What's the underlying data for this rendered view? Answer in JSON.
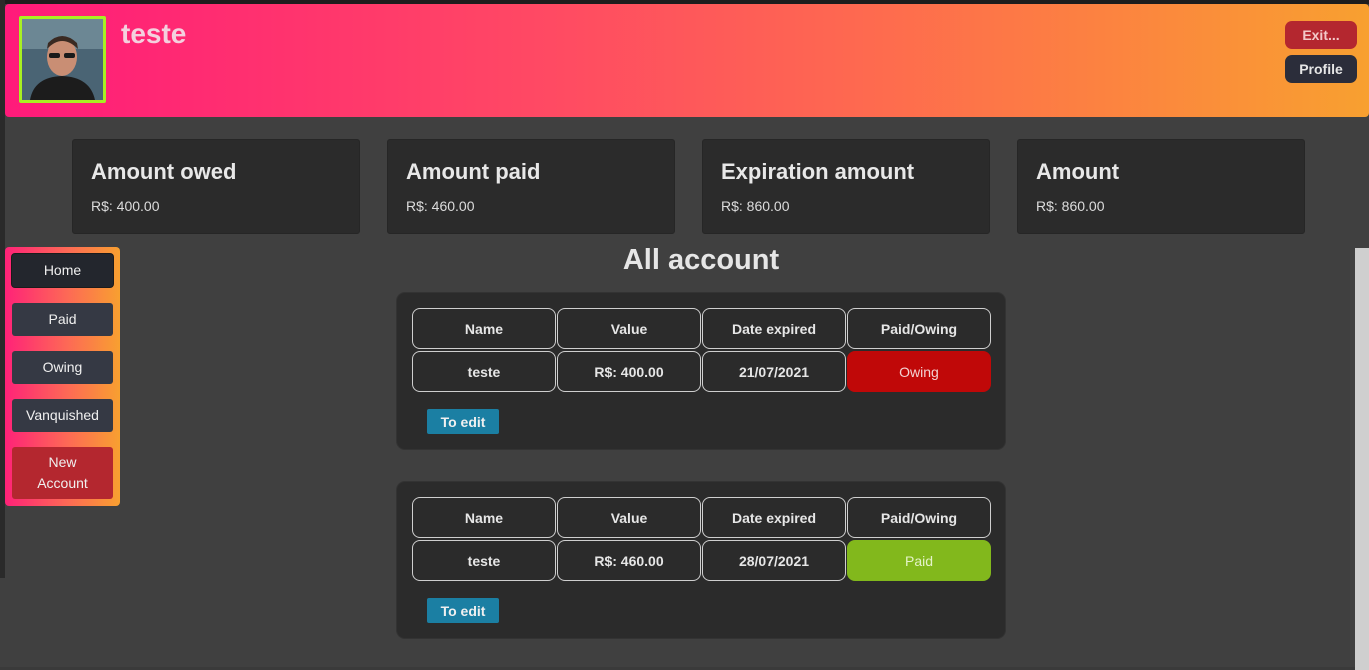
{
  "header": {
    "username": "teste",
    "exit_label": "Exit...",
    "profile_label": "Profile"
  },
  "summary": [
    {
      "title": "Amount owed",
      "value": "R$: 400.00"
    },
    {
      "title": "Amount paid",
      "value": "R$: 460.00"
    },
    {
      "title": "Expiration amount",
      "value": "R$: 860.00"
    },
    {
      "title": "Amount",
      "value": "R$: 860.00"
    }
  ],
  "sidebar": {
    "items": [
      {
        "label": "Home"
      },
      {
        "label": "Paid"
      },
      {
        "label": "Owing"
      },
      {
        "label": "Vanquished"
      },
      {
        "label": "New Account"
      }
    ]
  },
  "main": {
    "heading": "All account",
    "columns": [
      "Name",
      "Value",
      "Date expired",
      "Paid/Owing"
    ],
    "accounts": [
      {
        "name": "teste",
        "value": "R$: 400.00",
        "date": "21/07/2021",
        "status": "Owing",
        "edit_label": "To edit"
      },
      {
        "name": "teste",
        "value": "R$: 460.00",
        "date": "28/07/2021",
        "status": "Paid",
        "edit_label": "To edit"
      }
    ]
  },
  "colors": {
    "owing": "#c00808",
    "paid": "#82b81c",
    "edit": "#1b7fa3",
    "exit": "#b4272f"
  }
}
